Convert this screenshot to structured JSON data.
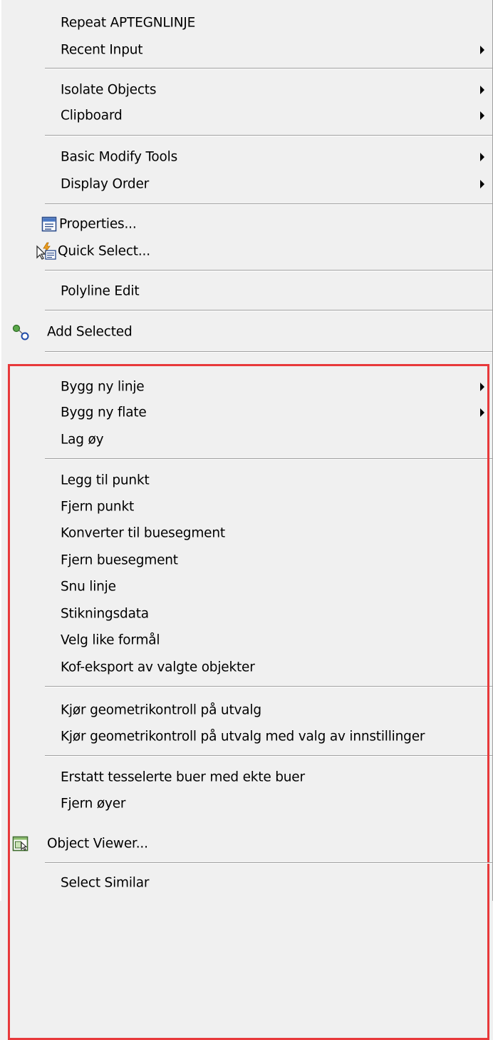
{
  "menu": {
    "repeat": "Repeat APTEGNLINJE",
    "recent_input": "Recent Input",
    "isolate_objects": "Isolate Objects",
    "clipboard": "Clipboard",
    "basic_modify_tools": "Basic Modify Tools",
    "display_order": "Display Order",
    "properties": "Properties...",
    "quick_select": "Quick Select...",
    "polyline_edit": "Polyline Edit",
    "add_selected": "Add Selected",
    "bygg_ny_linje": "Bygg ny linje",
    "bygg_ny_flate": "Bygg ny flate",
    "lag_oy": "Lag øy",
    "legg_til_punkt": "Legg til punkt",
    "fjern_punkt": "Fjern punkt",
    "konverter": "Konverter til buesegment",
    "fjern_buesegment": "Fjern buesegment",
    "snu_linje": "Snu linje",
    "stikningsdata": "Stikningsdata",
    "velg_like": "Velg like formål",
    "kof_eksport": "Kof-eksport av valgte objekter",
    "geo_utvalg": "Kjør geometrikontroll på utvalg",
    "geo_utvalg_valg": "Kjør geometrikontroll på utvalg med valg av innstillinger",
    "erstatt": "Erstatt tesselerte buer med ekte buer",
    "fjern_oyer": "Fjern øyer",
    "object_viewer": "Object Viewer...",
    "select_similar": "Select Similar"
  },
  "icons": {
    "properties": "properties-icon",
    "quick_select": "quick-select-icon",
    "add_selected": "add-selected-icon",
    "object_viewer": "object-viewer-icon",
    "submenu": "chevron-right-icon"
  },
  "colors": {
    "highlight_border": "#e8393b",
    "menu_bg": "#f0f0f0"
  }
}
